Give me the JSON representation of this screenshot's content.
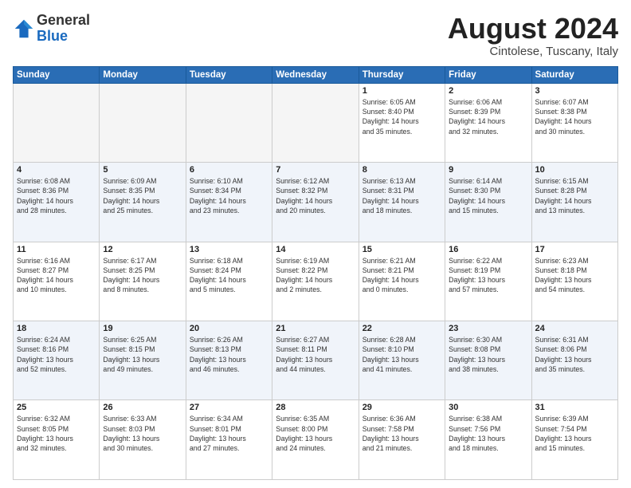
{
  "logo": {
    "general": "General",
    "blue": "Blue"
  },
  "title": "August 2024",
  "subtitle": "Cintolese, Tuscany, Italy",
  "days": [
    "Sunday",
    "Monday",
    "Tuesday",
    "Wednesday",
    "Thursday",
    "Friday",
    "Saturday"
  ],
  "weeks": [
    [
      {
        "day": "",
        "info": ""
      },
      {
        "day": "",
        "info": ""
      },
      {
        "day": "",
        "info": ""
      },
      {
        "day": "",
        "info": ""
      },
      {
        "day": "1",
        "info": "Sunrise: 6:05 AM\nSunset: 8:40 PM\nDaylight: 14 hours\nand 35 minutes."
      },
      {
        "day": "2",
        "info": "Sunrise: 6:06 AM\nSunset: 8:39 PM\nDaylight: 14 hours\nand 32 minutes."
      },
      {
        "day": "3",
        "info": "Sunrise: 6:07 AM\nSunset: 8:38 PM\nDaylight: 14 hours\nand 30 minutes."
      }
    ],
    [
      {
        "day": "4",
        "info": "Sunrise: 6:08 AM\nSunset: 8:36 PM\nDaylight: 14 hours\nand 28 minutes."
      },
      {
        "day": "5",
        "info": "Sunrise: 6:09 AM\nSunset: 8:35 PM\nDaylight: 14 hours\nand 25 minutes."
      },
      {
        "day": "6",
        "info": "Sunrise: 6:10 AM\nSunset: 8:34 PM\nDaylight: 14 hours\nand 23 minutes."
      },
      {
        "day": "7",
        "info": "Sunrise: 6:12 AM\nSunset: 8:32 PM\nDaylight: 14 hours\nand 20 minutes."
      },
      {
        "day": "8",
        "info": "Sunrise: 6:13 AM\nSunset: 8:31 PM\nDaylight: 14 hours\nand 18 minutes."
      },
      {
        "day": "9",
        "info": "Sunrise: 6:14 AM\nSunset: 8:30 PM\nDaylight: 14 hours\nand 15 minutes."
      },
      {
        "day": "10",
        "info": "Sunrise: 6:15 AM\nSunset: 8:28 PM\nDaylight: 14 hours\nand 13 minutes."
      }
    ],
    [
      {
        "day": "11",
        "info": "Sunrise: 6:16 AM\nSunset: 8:27 PM\nDaylight: 14 hours\nand 10 minutes."
      },
      {
        "day": "12",
        "info": "Sunrise: 6:17 AM\nSunset: 8:25 PM\nDaylight: 14 hours\nand 8 minutes."
      },
      {
        "day": "13",
        "info": "Sunrise: 6:18 AM\nSunset: 8:24 PM\nDaylight: 14 hours\nand 5 minutes."
      },
      {
        "day": "14",
        "info": "Sunrise: 6:19 AM\nSunset: 8:22 PM\nDaylight: 14 hours\nand 2 minutes."
      },
      {
        "day": "15",
        "info": "Sunrise: 6:21 AM\nSunset: 8:21 PM\nDaylight: 14 hours\nand 0 minutes."
      },
      {
        "day": "16",
        "info": "Sunrise: 6:22 AM\nSunset: 8:19 PM\nDaylight: 13 hours\nand 57 minutes."
      },
      {
        "day": "17",
        "info": "Sunrise: 6:23 AM\nSunset: 8:18 PM\nDaylight: 13 hours\nand 54 minutes."
      }
    ],
    [
      {
        "day": "18",
        "info": "Sunrise: 6:24 AM\nSunset: 8:16 PM\nDaylight: 13 hours\nand 52 minutes."
      },
      {
        "day": "19",
        "info": "Sunrise: 6:25 AM\nSunset: 8:15 PM\nDaylight: 13 hours\nand 49 minutes."
      },
      {
        "day": "20",
        "info": "Sunrise: 6:26 AM\nSunset: 8:13 PM\nDaylight: 13 hours\nand 46 minutes."
      },
      {
        "day": "21",
        "info": "Sunrise: 6:27 AM\nSunset: 8:11 PM\nDaylight: 13 hours\nand 44 minutes."
      },
      {
        "day": "22",
        "info": "Sunrise: 6:28 AM\nSunset: 8:10 PM\nDaylight: 13 hours\nand 41 minutes."
      },
      {
        "day": "23",
        "info": "Sunrise: 6:30 AM\nSunset: 8:08 PM\nDaylight: 13 hours\nand 38 minutes."
      },
      {
        "day": "24",
        "info": "Sunrise: 6:31 AM\nSunset: 8:06 PM\nDaylight: 13 hours\nand 35 minutes."
      }
    ],
    [
      {
        "day": "25",
        "info": "Sunrise: 6:32 AM\nSunset: 8:05 PM\nDaylight: 13 hours\nand 32 minutes."
      },
      {
        "day": "26",
        "info": "Sunrise: 6:33 AM\nSunset: 8:03 PM\nDaylight: 13 hours\nand 30 minutes."
      },
      {
        "day": "27",
        "info": "Sunrise: 6:34 AM\nSunset: 8:01 PM\nDaylight: 13 hours\nand 27 minutes."
      },
      {
        "day": "28",
        "info": "Sunrise: 6:35 AM\nSunset: 8:00 PM\nDaylight: 13 hours\nand 24 minutes."
      },
      {
        "day": "29",
        "info": "Sunrise: 6:36 AM\nSunset: 7:58 PM\nDaylight: 13 hours\nand 21 minutes."
      },
      {
        "day": "30",
        "info": "Sunrise: 6:38 AM\nSunset: 7:56 PM\nDaylight: 13 hours\nand 18 minutes."
      },
      {
        "day": "31",
        "info": "Sunrise: 6:39 AM\nSunset: 7:54 PM\nDaylight: 13 hours\nand 15 minutes."
      }
    ]
  ]
}
